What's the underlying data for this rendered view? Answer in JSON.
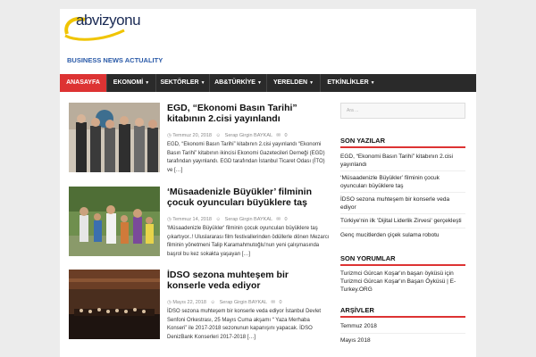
{
  "site": {
    "logo_text": "abvizyonu",
    "tagline": "BUSINESS NEWS ACTUALITY"
  },
  "nav": {
    "items": [
      {
        "label": "ANASAYFA",
        "active": true,
        "has_dropdown": false
      },
      {
        "label": "EKONOMİ",
        "active": false,
        "has_dropdown": true
      },
      {
        "label": "SEKTÖRLER",
        "active": false,
        "has_dropdown": true
      },
      {
        "label": "AB&TÜRKİYE",
        "active": false,
        "has_dropdown": true
      },
      {
        "label": "YERELDEN",
        "active": false,
        "has_dropdown": true
      },
      {
        "label": "ETKİNLİKLER",
        "active": false,
        "has_dropdown": true
      }
    ]
  },
  "articles": [
    {
      "title": "EGD, “Ekonomi Basın Tarihi” kitabının 2.cisi yayınlandı",
      "date": "Temmuz 20, 2018",
      "author": "Serap Girgin BAYKAL",
      "comments": "0",
      "excerpt": "EGD, “Ekonomi Basın Tarihi” kitabının 2.cisi yayınlandı “Ekonomi Basın Tarihi” kitabının ikincisi Ekonomi Gazetecileri Derneği (EGD) tarafından yayınlandı. EGD tarafından İstanbul Ticaret Odası (İTO) ve […]"
    },
    {
      "title": "‘Müsaadenizle Büyükler’ filminin çocuk oyuncuları büyüklere taş",
      "date": "Temmuz 14, 2018",
      "author": "Serap Girgin BAYKAL",
      "comments": "0",
      "excerpt": "'Müsaadenizle Büyükler' filminin çocuk oyuncuları büyüklere taş çıkartıyor..! Uluslararası film festivallerinden ödüllerle dönen Mezarcı filminin yönetmeni Talip Karamahmutoğlu'nun yeni çalışmasında başrol bu kez sokakta yaşayan […]"
    },
    {
      "title": "İDSO sezona muhteşem bir konserle veda ediyor",
      "date": "Mayıs 22, 2018",
      "author": "Serap Girgin BAYKAL",
      "comments": "0",
      "excerpt": "İDSO sezona muhteşem bir konserle veda ediyor İstanbul Devlet Senfoni Orkestrası, 25 Mayıs Cuma akşamı “ Yaza Merhaba Konseri” ile 2017-2018 sezonunun kapanışını yapacak. İDSO DenizBank Konserleri 2017-2018 […]"
    }
  ],
  "sidebar": {
    "search_placeholder": "Ara ...",
    "widgets": [
      {
        "title": "SON YAZILAR",
        "items": [
          "EGD, “Ekonomi Basın Tarihi” kitabının 2.cisi yayınlandı",
          "‘Müsaadenizle Büyükler’ filminin çocuk oyuncuları büyüklere taş",
          "İDSO sezona muhteşem bir konserle veda ediyor",
          "Türkiye'nin ilk 'Dijital Liderlik Zirvesi' gerçekleşti",
          "Genç mucitlerden çiçek sulama robotu"
        ]
      },
      {
        "title": "SON YORUMLAR",
        "items": [
          "Turizmci Gürcan Koşar'ın başarı öyküsü için Turizmci Gürcan Koşar'ın Başarı Öyküsü | E-Turkey.ORG"
        ]
      },
      {
        "title": "ARŞİVLER",
        "items": [
          "Temmuz 2018",
          "Mayıs 2018"
        ]
      }
    ]
  },
  "colors": {
    "accent": "#dd3333",
    "nav_bg": "#2a2a2a",
    "tagline": "#2a5aa8"
  },
  "icons": {
    "meta_date": "clock-icon",
    "meta_author": "user-icon",
    "meta_comments": "comment-icon",
    "nav_dropdown": "caret-down-icon"
  }
}
